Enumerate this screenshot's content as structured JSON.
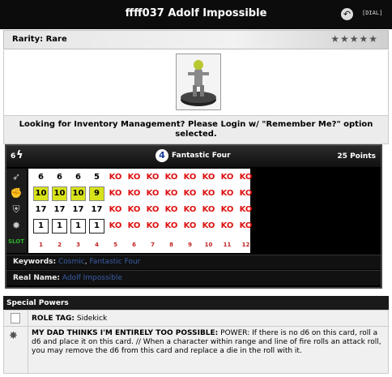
{
  "header": {
    "title": "ffff037 Adolf Impossible",
    "dial_link": "[DIAL]"
  },
  "rarity": {
    "label": "Rarity: Rare",
    "stars": "★★★★★"
  },
  "notice": {
    "line1": "Looking for Inventory Management? Please Login w/ \"Remember Me?\" option",
    "line2": "selected."
  },
  "dial": {
    "range": "6",
    "team_number": "4",
    "team_name": "Fantastic Four",
    "points": "25 Points",
    "slot_label": "SLOT",
    "clicks": [
      "1",
      "2",
      "3",
      "4",
      "5",
      "6",
      "7",
      "8",
      "9",
      "10",
      "11",
      "12"
    ],
    "rows": [
      [
        "6",
        "6",
        "6",
        "5",
        "KO",
        "KO",
        "KO",
        "KO",
        "KO",
        "KO",
        "KO",
        "KO"
      ],
      [
        "10",
        "10",
        "10",
        "9",
        "KO",
        "KO",
        "KO",
        "KO",
        "KO",
        "KO",
        "KO",
        "KO"
      ],
      [
        "17",
        "17",
        "17",
        "17",
        "KO",
        "KO",
        "KO",
        "KO",
        "KO",
        "KO",
        "KO",
        "KO"
      ],
      [
        "1",
        "1",
        "1",
        "1",
        "KO",
        "KO",
        "KO",
        "KO",
        "KO",
        "KO",
        "KO",
        "KO"
      ]
    ],
    "keywords_label": "Keywords:",
    "keyword1": "Cosmic",
    "keyword_sep": ",",
    "keyword2": "Fantastic Four",
    "real_name_label": "Real Name:",
    "real_name": "Adolf Impossible"
  },
  "special_powers": {
    "header": "Special Powers",
    "role_tag": "ROLE TAG:",
    "role_value": "Sidekick",
    "power_name": "MY DAD THINKS I'M ENTIRELY TOO POSSIBLE:",
    "power_text": "POWER: If there is no d6 on this card, roll a d6 and place it on this card. // When a character within range and line of fire rolls an attack roll, you may remove the d6 from this card and replace a die in the roll with it."
  }
}
